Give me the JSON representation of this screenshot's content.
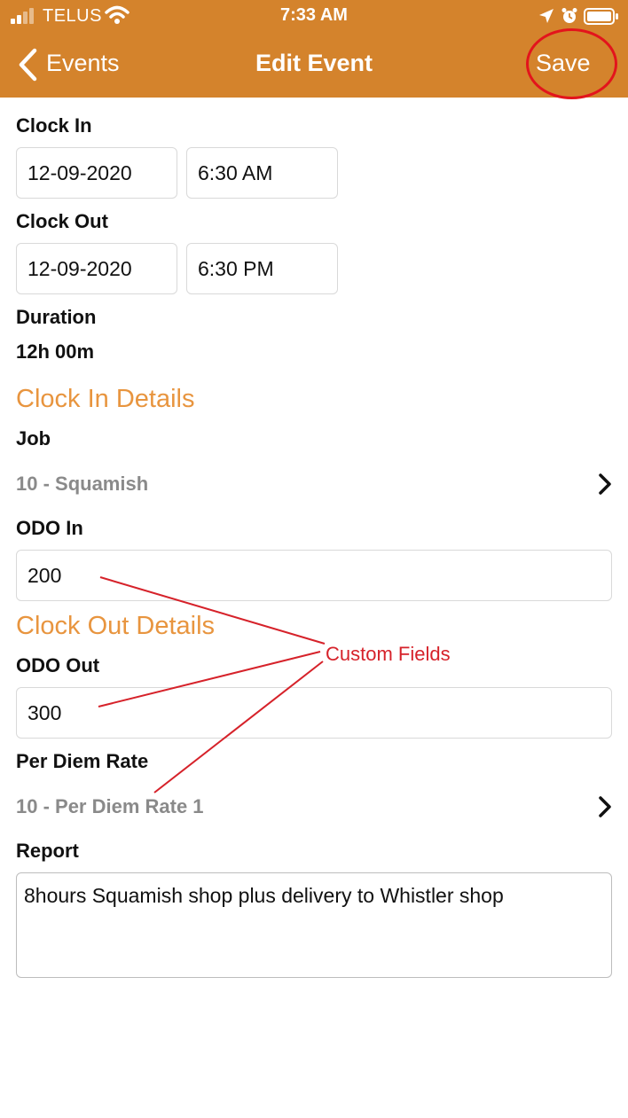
{
  "status_bar": {
    "carrier": "TELUS",
    "time": "7:33 AM"
  },
  "nav": {
    "back_label": "Events",
    "title": "Edit Event",
    "save_label": "Save"
  },
  "clock_in": {
    "label": "Clock In",
    "date": "12-09-2020",
    "time": "6:30 AM"
  },
  "clock_out": {
    "label": "Clock Out",
    "date": "12-09-2020",
    "time": "6:30 PM"
  },
  "duration": {
    "label": "Duration",
    "value": "12h 00m"
  },
  "clock_in_details": {
    "heading": "Clock In Details",
    "job_label": "Job",
    "job_value": "10 - Squamish",
    "odo_in_label": "ODO In",
    "odo_in_value": "200"
  },
  "clock_out_details": {
    "heading": "Clock Out Details",
    "odo_out_label": "ODO Out",
    "odo_out_value": "300",
    "per_diem_label": "Per Diem Rate",
    "per_diem_value": "10 - Per Diem Rate 1"
  },
  "report": {
    "label": "Report",
    "value": "8hours Squamish shop plus delivery to Whistler shop"
  },
  "annotation": {
    "text": "Custom Fields",
    "color": "#D6222A"
  },
  "colors": {
    "brand": "#D4832C",
    "section_heading": "#E8953F",
    "picker_text": "#8A8A8A"
  }
}
